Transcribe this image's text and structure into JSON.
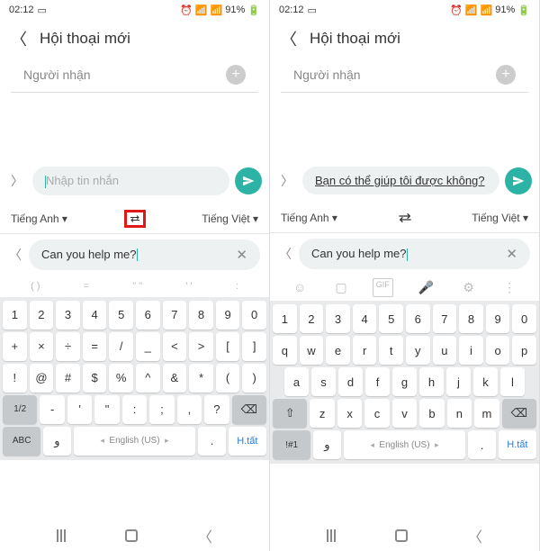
{
  "status": {
    "time": "02:12",
    "battery": "91%"
  },
  "header": {
    "title": "Hội thoại mới"
  },
  "recipient": {
    "label": "Người nhận"
  },
  "compose": {
    "placeholder": "Nhập tin nhắn",
    "translated": "Bạn có thể giúp tôi được không?"
  },
  "lang": {
    "source": "Tiếng Anh ▾",
    "target": "Tiếng Việt ▾"
  },
  "trans": {
    "text": "Can you help me?"
  },
  "toolbar_sym": [
    "( )",
    "=",
    "\"  \"",
    "'  '",
    ":"
  ],
  "kb_sym": {
    "r1": [
      "1",
      "2",
      "3",
      "4",
      "5",
      "6",
      "7",
      "8",
      "9",
      "0"
    ],
    "r2": [
      "+",
      "×",
      "÷",
      "=",
      "/",
      "_",
      "<",
      ">",
      "[",
      "]"
    ],
    "r3": [
      "!",
      "@",
      "#",
      "$",
      "%",
      "^",
      "&",
      "*",
      "(",
      ")"
    ],
    "r4_left": "1/2",
    "r4_mid": [
      "-",
      "'",
      "\"",
      ":",
      ";",
      ",",
      "?"
    ],
    "r5_left": "ABC",
    "r5_space": "English (US)",
    "r5_dot": ".",
    "r5_right": "H.tất"
  },
  "kb_alpha": {
    "r1": [
      "1",
      "2",
      "3",
      "4",
      "5",
      "6",
      "7",
      "8",
      "9",
      "0"
    ],
    "r2": [
      "q",
      "w",
      "e",
      "r",
      "t",
      "y",
      "u",
      "i",
      "o",
      "p"
    ],
    "r3": [
      "a",
      "s",
      "d",
      "f",
      "g",
      "h",
      "j",
      "k",
      "l"
    ],
    "r4_mid": [
      "z",
      "x",
      "c",
      "v",
      "b",
      "n",
      "m"
    ],
    "r5_left": "!#1",
    "r5_space": "English (US)",
    "r5_dot": ".",
    "r5_right": "H.tất"
  }
}
